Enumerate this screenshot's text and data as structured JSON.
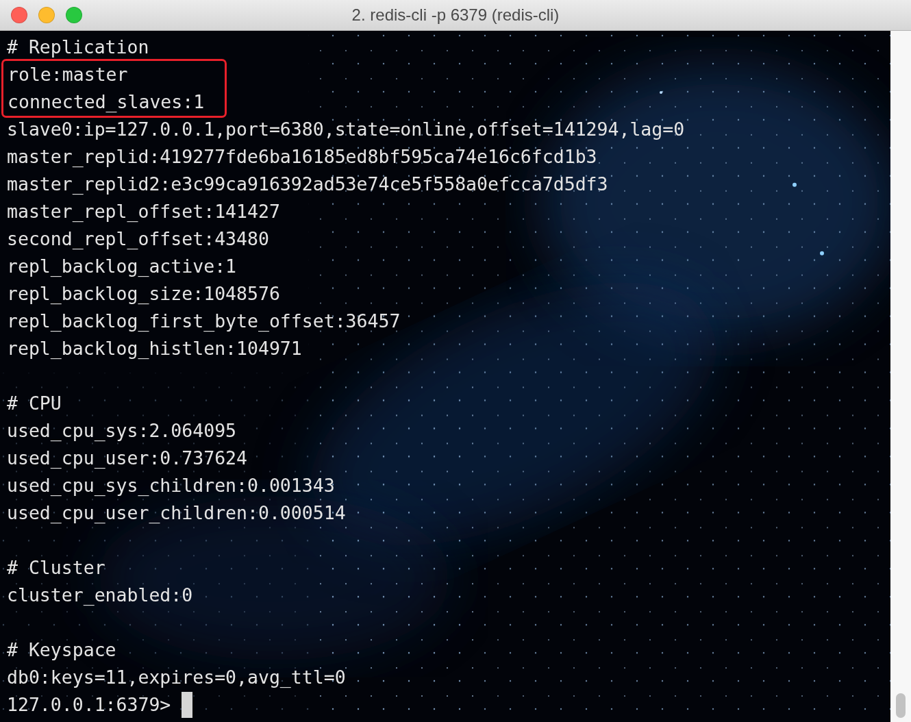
{
  "window": {
    "title": "2. redis-cli -p 6379 (redis-cli)"
  },
  "sections": [
    {
      "lines": [
        {
          "text": "# Replication",
          "highlighted": false
        },
        {
          "text": "role:master",
          "highlighted": true
        },
        {
          "text": "connected_slaves:1",
          "highlighted": true
        },
        {
          "text": "slave0:ip=127.0.0.1,port=6380,state=online,offset=141294,lag=0",
          "highlighted": false
        },
        {
          "text": "master_replid:419277fde6ba16185ed8bf595ca74e16c6fcd1b3",
          "highlighted": false
        },
        {
          "text": "master_replid2:e3c99ca916392ad53e74ce5f558a0efcca7d5df3",
          "highlighted": false
        },
        {
          "text": "master_repl_offset:141427",
          "highlighted": false
        },
        {
          "text": "second_repl_offset:43480",
          "highlighted": false
        },
        {
          "text": "repl_backlog_active:1",
          "highlighted": false
        },
        {
          "text": "repl_backlog_size:1048576",
          "highlighted": false
        },
        {
          "text": "repl_backlog_first_byte_offset:36457",
          "highlighted": false
        },
        {
          "text": "repl_backlog_histlen:104971",
          "highlighted": false
        }
      ]
    },
    {
      "lines": [
        {
          "text": "# CPU",
          "highlighted": false
        },
        {
          "text": "used_cpu_sys:2.064095",
          "highlighted": false
        },
        {
          "text": "used_cpu_user:0.737624",
          "highlighted": false
        },
        {
          "text": "used_cpu_sys_children:0.001343",
          "highlighted": false
        },
        {
          "text": "used_cpu_user_children:0.000514",
          "highlighted": false
        }
      ]
    },
    {
      "lines": [
        {
          "text": "# Cluster",
          "highlighted": false
        },
        {
          "text": "cluster_enabled:0",
          "highlighted": false
        }
      ]
    },
    {
      "lines": [
        {
          "text": "# Keyspace",
          "highlighted": false
        },
        {
          "text": "db0:keys=11,expires=0,avg_ttl=0",
          "highlighted": false
        }
      ]
    }
  ],
  "prompt": {
    "text": "127.0.0.1:6379>"
  }
}
